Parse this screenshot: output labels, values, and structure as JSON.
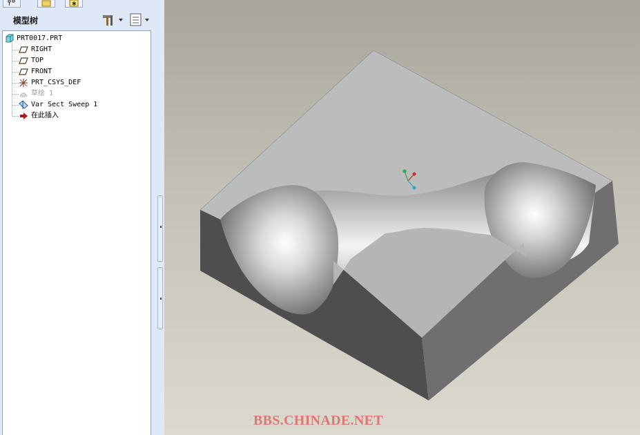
{
  "nav_tabs": [
    {
      "icon": "model-tree-tab-icon"
    },
    {
      "icon": "folder-browser-tab-icon"
    },
    {
      "icon": "favorites-tab-icon"
    }
  ],
  "model_tree": {
    "title": "模型树",
    "settings_icon": "tree-settings-icon",
    "columns_icon": "tree-columns-icon",
    "root": {
      "label": "PRT0017.PRT",
      "icon": "part-icon"
    },
    "items": [
      {
        "label": "RIGHT",
        "icon": "datum-plane-icon",
        "dimmed": false
      },
      {
        "label": "TOP",
        "icon": "datum-plane-icon",
        "dimmed": false
      },
      {
        "label": "FRONT",
        "icon": "datum-plane-icon",
        "dimmed": false
      },
      {
        "label": "PRT_CSYS_DEF",
        "icon": "coordinate-system-icon",
        "dimmed": false
      },
      {
        "label": "草绘 1",
        "icon": "sketch-icon",
        "dimmed": true
      },
      {
        "label": "Var Sect Sweep 1",
        "icon": "sweep-feature-icon",
        "dimmed": false
      },
      {
        "label": "在此插入",
        "icon": "insert-here-arrow-icon",
        "dimmed": false
      }
    ]
  },
  "viewport": {
    "watermark": "BBS.CHINADE.NET",
    "background_top": "#a8a69b",
    "background_bottom": "#dcdacf"
  },
  "colors": {
    "panel_bg": "#dfe8f6",
    "tree_bg": "#ffffff",
    "watermark": "#e07575"
  }
}
